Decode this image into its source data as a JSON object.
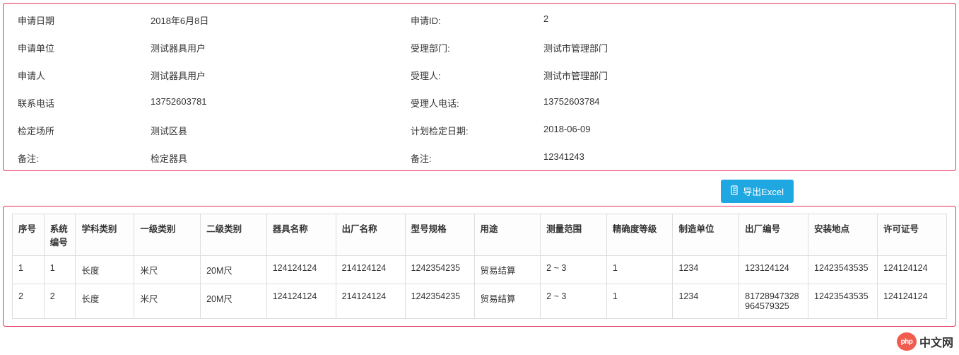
{
  "info": {
    "labels": {
      "apply_date": "申请日期",
      "apply_id": "申请ID:",
      "apply_unit": "申请单位",
      "accept_dept": "受理部门:",
      "applicant": "申请人",
      "acceptor": "受理人:",
      "contact_phone": "联系电话",
      "acceptor_phone": "受理人电话:",
      "inspect_location": "检定场所",
      "plan_date": "计划检定日期:",
      "remark_left": "备注:",
      "remark_right": "备注:"
    },
    "values": {
      "apply_date": "2018年6月8日",
      "apply_id": "2",
      "apply_unit": "测试器具用户",
      "accept_dept": "测试市管理部门",
      "applicant": "测试器具用户",
      "acceptor": "测试市管理部门",
      "contact_phone": "13752603781",
      "acceptor_phone": "13752603784",
      "inspect_location": "测试区县",
      "plan_date": "2018-06-09",
      "remark_left": "检定器具",
      "remark_right": "12341243"
    }
  },
  "toolbar": {
    "export_label": "导出Excel"
  },
  "table": {
    "headers": {
      "seq": "序号",
      "sys_no": "系统编号",
      "subject": "学科类别",
      "cat1": "一级类别",
      "cat2": "二级类别",
      "name": "器具名称",
      "factory_name": "出厂名称",
      "model": "型号规格",
      "usage": "用途",
      "range": "测量范围",
      "accuracy": "精确度等级",
      "manufacturer": "制造单位",
      "serial_no": "出厂编号",
      "install_loc": "安装地点",
      "license_no": "许可证号"
    },
    "rows": [
      {
        "seq": "1",
        "sys_no": "1",
        "subject": "长度",
        "cat1": "米尺",
        "cat2": "20M尺",
        "name": "124124124",
        "factory_name": "214124124",
        "model": "1242354235",
        "usage": "贸易结算",
        "range": "2 ~ 3",
        "accuracy": "1",
        "manufacturer": "1234",
        "serial_no": "123124124",
        "install_loc": "12423543535",
        "license_no": "124124124"
      },
      {
        "seq": "2",
        "sys_no": "2",
        "subject": "长度",
        "cat1": "米尺",
        "cat2": "20M尺",
        "name": "124124124",
        "factory_name": "214124124",
        "model": "1242354235",
        "usage": "贸易结算",
        "range": "2 ~ 3",
        "accuracy": "1",
        "manufacturer": "1234",
        "serial_no": "81728947328964579325",
        "install_loc": "12423543535",
        "license_no": "124124124"
      }
    ]
  },
  "watermark": {
    "badge": "php",
    "text": "中文网"
  }
}
